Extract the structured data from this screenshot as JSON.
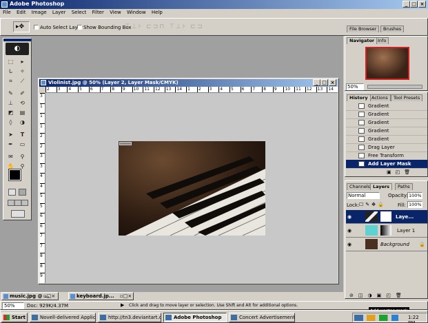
{
  "app": {
    "title": "Adobe Photoshop",
    "menu": [
      "File",
      "Edit",
      "Image",
      "Layer",
      "Select",
      "Filter",
      "View",
      "Window",
      "Help"
    ]
  },
  "options_bar": {
    "auto_select_label": "Auto Select Layer",
    "bounding_box_label": "Show Bounding Box"
  },
  "document": {
    "title": "Violinist.jpg @ 50% (Layer 2, Layer Mask/CMYK)",
    "h_ruler": [
      "2",
      "3",
      "4",
      "5",
      "6",
      "7",
      "8",
      "9",
      "10",
      "11",
      "12",
      "13",
      "14",
      "1",
      "2",
      "3",
      "4",
      "5",
      "6",
      "7",
      "8",
      "9",
      "10",
      "11",
      "12",
      "13",
      "14"
    ],
    "v_ruler": [
      "3",
      "1",
      "1",
      "1",
      "2",
      "2",
      "3",
      "3",
      "4",
      "4",
      "5",
      "5",
      "6",
      "6",
      "7",
      "7",
      "8",
      "8",
      "9"
    ]
  },
  "palette_tabs_top": {
    "file_browser": "File Browser",
    "brushes": "Brushes"
  },
  "navigator": {
    "tab": "Navigator",
    "info_tab": "Info",
    "zoom": "50%"
  },
  "history": {
    "tabs": [
      "History",
      "Actions",
      "Tool Presets"
    ],
    "items": [
      "Gradient",
      "Gradient",
      "Gradient",
      "Gradient",
      "Gradient",
      "Drag Layer",
      "Free Transform",
      "Add Layer Mask"
    ]
  },
  "layers": {
    "tabs": [
      "Channels",
      "Layers",
      "Paths"
    ],
    "blend_mode": "Normal",
    "opacity_label": "Opacity:",
    "opacity_value": "100%",
    "lock_label": "Lock:",
    "fill_label": "Fill:",
    "fill_value": "100%",
    "items": [
      "Laye...",
      "Layer 1",
      "Background"
    ]
  },
  "minimized_docs": [
    "music.jpg @ ...",
    "keyboard.jp..."
  ],
  "status": {
    "zoom": "50%",
    "doc_info": "Doc: 929K/4.37M",
    "message": "Click and drag to move layer or selection. Use Shift and Alt for additional options."
  },
  "tooltip": "Add vector mask",
  "taskbar": {
    "start": "Start",
    "items": [
      "Novell-delivered Applicati...",
      "http://tn3.deviantart.co...",
      "Adobe Photoshop",
      "Concert Advertisement -..."
    ],
    "clock": "1:22 PM"
  },
  "colors": {
    "titlebar": "#0a246a",
    "highlight": "#0a246a",
    "workspace": "#a0a0a0"
  }
}
